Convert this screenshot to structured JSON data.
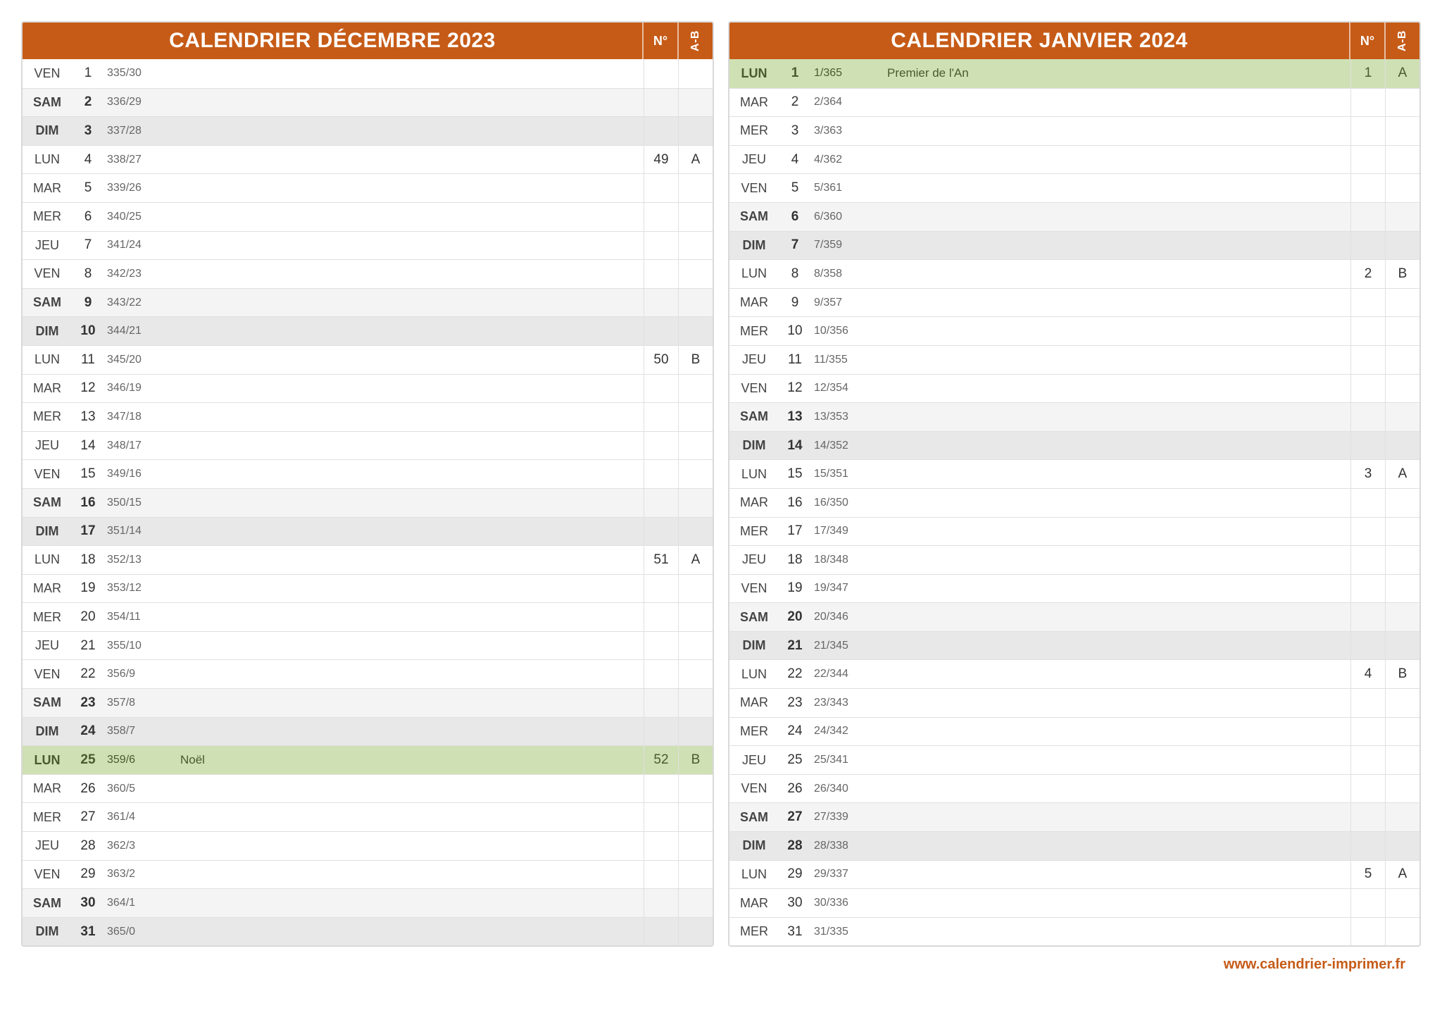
{
  "header_labels": {
    "week_no": "N°",
    "ab": "A-B"
  },
  "footer": "www.calendrier-imprimer.fr",
  "months": [
    {
      "title": "CALENDRIER DÉCEMBRE 2023",
      "days": [
        {
          "dow": "VEN",
          "n": "1",
          "ord": "335/30",
          "note": "",
          "wk": "",
          "ab": "",
          "cls": ""
        },
        {
          "dow": "SAM",
          "n": "2",
          "ord": "336/29",
          "note": "",
          "wk": "",
          "ab": "",
          "cls": "sat"
        },
        {
          "dow": "DIM",
          "n": "3",
          "ord": "337/28",
          "note": "",
          "wk": "",
          "ab": "",
          "cls": "sun"
        },
        {
          "dow": "LUN",
          "n": "4",
          "ord": "338/27",
          "note": "",
          "wk": "49",
          "ab": "A",
          "cls": ""
        },
        {
          "dow": "MAR",
          "n": "5",
          "ord": "339/26",
          "note": "",
          "wk": "",
          "ab": "",
          "cls": ""
        },
        {
          "dow": "MER",
          "n": "6",
          "ord": "340/25",
          "note": "",
          "wk": "",
          "ab": "",
          "cls": ""
        },
        {
          "dow": "JEU",
          "n": "7",
          "ord": "341/24",
          "note": "",
          "wk": "",
          "ab": "",
          "cls": ""
        },
        {
          "dow": "VEN",
          "n": "8",
          "ord": "342/23",
          "note": "",
          "wk": "",
          "ab": "",
          "cls": ""
        },
        {
          "dow": "SAM",
          "n": "9",
          "ord": "343/22",
          "note": "",
          "wk": "",
          "ab": "",
          "cls": "sat"
        },
        {
          "dow": "DIM",
          "n": "10",
          "ord": "344/21",
          "note": "",
          "wk": "",
          "ab": "",
          "cls": "sun"
        },
        {
          "dow": "LUN",
          "n": "11",
          "ord": "345/20",
          "note": "",
          "wk": "50",
          "ab": "B",
          "cls": ""
        },
        {
          "dow": "MAR",
          "n": "12",
          "ord": "346/19",
          "note": "",
          "wk": "",
          "ab": "",
          "cls": ""
        },
        {
          "dow": "MER",
          "n": "13",
          "ord": "347/18",
          "note": "",
          "wk": "",
          "ab": "",
          "cls": ""
        },
        {
          "dow": "JEU",
          "n": "14",
          "ord": "348/17",
          "note": "",
          "wk": "",
          "ab": "",
          "cls": ""
        },
        {
          "dow": "VEN",
          "n": "15",
          "ord": "349/16",
          "note": "",
          "wk": "",
          "ab": "",
          "cls": ""
        },
        {
          "dow": "SAM",
          "n": "16",
          "ord": "350/15",
          "note": "",
          "wk": "",
          "ab": "",
          "cls": "sat"
        },
        {
          "dow": "DIM",
          "n": "17",
          "ord": "351/14",
          "note": "",
          "wk": "",
          "ab": "",
          "cls": "sun"
        },
        {
          "dow": "LUN",
          "n": "18",
          "ord": "352/13",
          "note": "",
          "wk": "51",
          "ab": "A",
          "cls": ""
        },
        {
          "dow": "MAR",
          "n": "19",
          "ord": "353/12",
          "note": "",
          "wk": "",
          "ab": "",
          "cls": ""
        },
        {
          "dow": "MER",
          "n": "20",
          "ord": "354/11",
          "note": "",
          "wk": "",
          "ab": "",
          "cls": ""
        },
        {
          "dow": "JEU",
          "n": "21",
          "ord": "355/10",
          "note": "",
          "wk": "",
          "ab": "",
          "cls": ""
        },
        {
          "dow": "VEN",
          "n": "22",
          "ord": "356/9",
          "note": "",
          "wk": "",
          "ab": "",
          "cls": ""
        },
        {
          "dow": "SAM",
          "n": "23",
          "ord": "357/8",
          "note": "",
          "wk": "",
          "ab": "",
          "cls": "sat"
        },
        {
          "dow": "DIM",
          "n": "24",
          "ord": "358/7",
          "note": "",
          "wk": "",
          "ab": "",
          "cls": "sun"
        },
        {
          "dow": "LUN",
          "n": "25",
          "ord": "359/6",
          "note": "Noël",
          "wk": "52",
          "ab": "B",
          "cls": "hol"
        },
        {
          "dow": "MAR",
          "n": "26",
          "ord": "360/5",
          "note": "",
          "wk": "",
          "ab": "",
          "cls": ""
        },
        {
          "dow": "MER",
          "n": "27",
          "ord": "361/4",
          "note": "",
          "wk": "",
          "ab": "",
          "cls": ""
        },
        {
          "dow": "JEU",
          "n": "28",
          "ord": "362/3",
          "note": "",
          "wk": "",
          "ab": "",
          "cls": ""
        },
        {
          "dow": "VEN",
          "n": "29",
          "ord": "363/2",
          "note": "",
          "wk": "",
          "ab": "",
          "cls": ""
        },
        {
          "dow": "SAM",
          "n": "30",
          "ord": "364/1",
          "note": "",
          "wk": "",
          "ab": "",
          "cls": "sat"
        },
        {
          "dow": "DIM",
          "n": "31",
          "ord": "365/0",
          "note": "",
          "wk": "",
          "ab": "",
          "cls": "sun"
        }
      ]
    },
    {
      "title": "CALENDRIER JANVIER 2024",
      "days": [
        {
          "dow": "LUN",
          "n": "1",
          "ord": "1/365",
          "note": "Premier de l'An",
          "wk": "1",
          "ab": "A",
          "cls": "hol"
        },
        {
          "dow": "MAR",
          "n": "2",
          "ord": "2/364",
          "note": "",
          "wk": "",
          "ab": "",
          "cls": ""
        },
        {
          "dow": "MER",
          "n": "3",
          "ord": "3/363",
          "note": "",
          "wk": "",
          "ab": "",
          "cls": ""
        },
        {
          "dow": "JEU",
          "n": "4",
          "ord": "4/362",
          "note": "",
          "wk": "",
          "ab": "",
          "cls": ""
        },
        {
          "dow": "VEN",
          "n": "5",
          "ord": "5/361",
          "note": "",
          "wk": "",
          "ab": "",
          "cls": ""
        },
        {
          "dow": "SAM",
          "n": "6",
          "ord": "6/360",
          "note": "",
          "wk": "",
          "ab": "",
          "cls": "sat"
        },
        {
          "dow": "DIM",
          "n": "7",
          "ord": "7/359",
          "note": "",
          "wk": "",
          "ab": "",
          "cls": "sun"
        },
        {
          "dow": "LUN",
          "n": "8",
          "ord": "8/358",
          "note": "",
          "wk": "2",
          "ab": "B",
          "cls": ""
        },
        {
          "dow": "MAR",
          "n": "9",
          "ord": "9/357",
          "note": "",
          "wk": "",
          "ab": "",
          "cls": ""
        },
        {
          "dow": "MER",
          "n": "10",
          "ord": "10/356",
          "note": "",
          "wk": "",
          "ab": "",
          "cls": ""
        },
        {
          "dow": "JEU",
          "n": "11",
          "ord": "11/355",
          "note": "",
          "wk": "",
          "ab": "",
          "cls": ""
        },
        {
          "dow": "VEN",
          "n": "12",
          "ord": "12/354",
          "note": "",
          "wk": "",
          "ab": "",
          "cls": ""
        },
        {
          "dow": "SAM",
          "n": "13",
          "ord": "13/353",
          "note": "",
          "wk": "",
          "ab": "",
          "cls": "sat"
        },
        {
          "dow": "DIM",
          "n": "14",
          "ord": "14/352",
          "note": "",
          "wk": "",
          "ab": "",
          "cls": "sun"
        },
        {
          "dow": "LUN",
          "n": "15",
          "ord": "15/351",
          "note": "",
          "wk": "3",
          "ab": "A",
          "cls": ""
        },
        {
          "dow": "MAR",
          "n": "16",
          "ord": "16/350",
          "note": "",
          "wk": "",
          "ab": "",
          "cls": ""
        },
        {
          "dow": "MER",
          "n": "17",
          "ord": "17/349",
          "note": "",
          "wk": "",
          "ab": "",
          "cls": ""
        },
        {
          "dow": "JEU",
          "n": "18",
          "ord": "18/348",
          "note": "",
          "wk": "",
          "ab": "",
          "cls": ""
        },
        {
          "dow": "VEN",
          "n": "19",
          "ord": "19/347",
          "note": "",
          "wk": "",
          "ab": "",
          "cls": ""
        },
        {
          "dow": "SAM",
          "n": "20",
          "ord": "20/346",
          "note": "",
          "wk": "",
          "ab": "",
          "cls": "sat"
        },
        {
          "dow": "DIM",
          "n": "21",
          "ord": "21/345",
          "note": "",
          "wk": "",
          "ab": "",
          "cls": "sun"
        },
        {
          "dow": "LUN",
          "n": "22",
          "ord": "22/344",
          "note": "",
          "wk": "4",
          "ab": "B",
          "cls": ""
        },
        {
          "dow": "MAR",
          "n": "23",
          "ord": "23/343",
          "note": "",
          "wk": "",
          "ab": "",
          "cls": ""
        },
        {
          "dow": "MER",
          "n": "24",
          "ord": "24/342",
          "note": "",
          "wk": "",
          "ab": "",
          "cls": ""
        },
        {
          "dow": "JEU",
          "n": "25",
          "ord": "25/341",
          "note": "",
          "wk": "",
          "ab": "",
          "cls": ""
        },
        {
          "dow": "VEN",
          "n": "26",
          "ord": "26/340",
          "note": "",
          "wk": "",
          "ab": "",
          "cls": ""
        },
        {
          "dow": "SAM",
          "n": "27",
          "ord": "27/339",
          "note": "",
          "wk": "",
          "ab": "",
          "cls": "sat"
        },
        {
          "dow": "DIM",
          "n": "28",
          "ord": "28/338",
          "note": "",
          "wk": "",
          "ab": "",
          "cls": "sun"
        },
        {
          "dow": "LUN",
          "n": "29",
          "ord": "29/337",
          "note": "",
          "wk": "5",
          "ab": "A",
          "cls": ""
        },
        {
          "dow": "MAR",
          "n": "30",
          "ord": "30/336",
          "note": "",
          "wk": "",
          "ab": "",
          "cls": ""
        },
        {
          "dow": "MER",
          "n": "31",
          "ord": "31/335",
          "note": "",
          "wk": "",
          "ab": "",
          "cls": ""
        }
      ]
    }
  ]
}
